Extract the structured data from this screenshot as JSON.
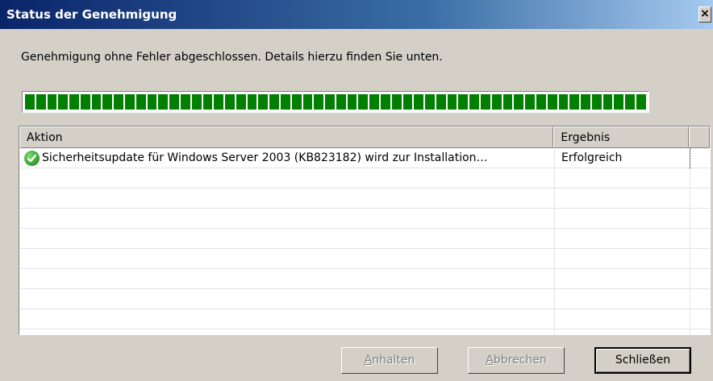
{
  "window": {
    "title": "Status der Genehmigung",
    "close_label": "×"
  },
  "message": "Genehmigung ohne Fehler abgeschlossen. Details hierzu finden Sie unten.",
  "progress": {
    "percent": 100,
    "color": "#007f00"
  },
  "table": {
    "columns": [
      "Aktion",
      "Ergebnis"
    ],
    "rows": [
      {
        "icon": "success-check-icon",
        "aktion": "Sicherheitsupdate für Windows Server 2003 (KB823182) wird zur Installation…",
        "ergebnis": "Erfolgreich"
      }
    ]
  },
  "buttons": {
    "anhalten": {
      "mnemonic": "A",
      "rest": "nhalten"
    },
    "abbrechen": {
      "mnemonic": "A",
      "rest": "bbrechen"
    },
    "schliessen": "Schließen"
  }
}
